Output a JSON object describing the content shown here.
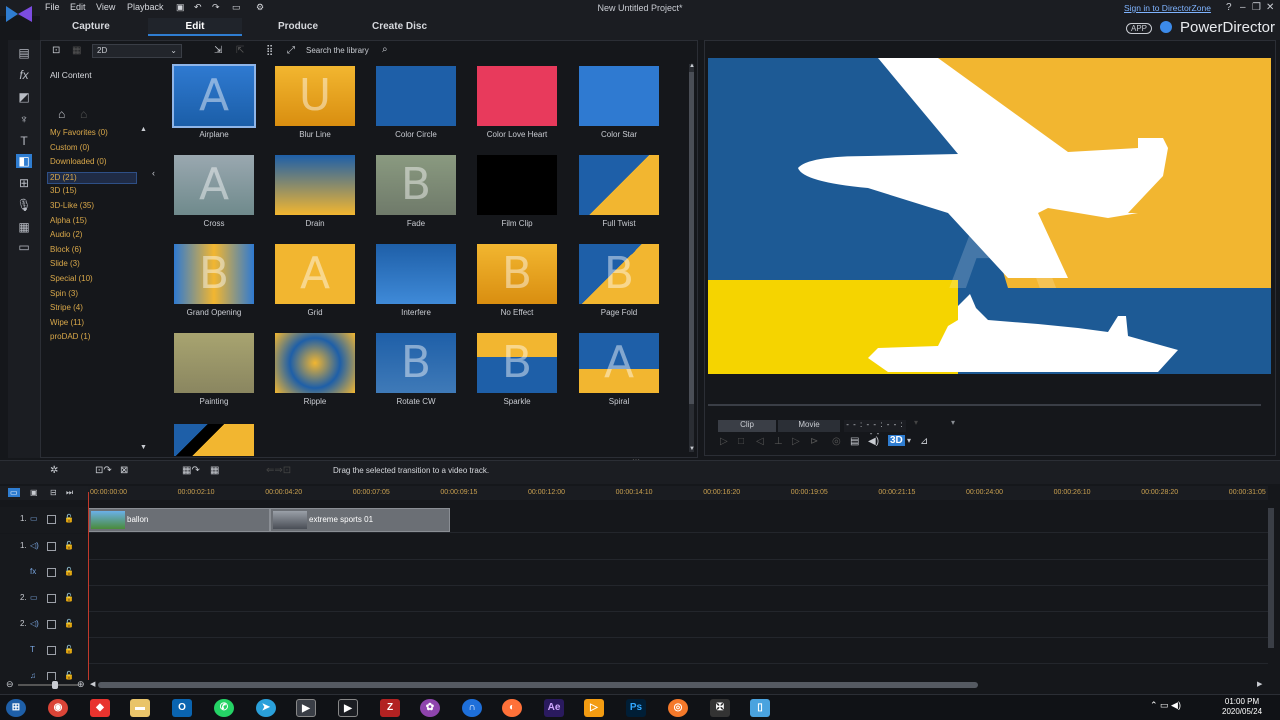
{
  "menu": {
    "file": "File",
    "edit": "Edit",
    "view": "View",
    "playback": "Playback"
  },
  "window": {
    "project_title": "New Untitled Project*",
    "signin": "Sign in to DirectorZone",
    "app_badge": "APP",
    "brand": "PowerDirector"
  },
  "modes": {
    "capture": "Capture",
    "edit": "Edit",
    "produce": "Produce",
    "create_disc": "Create Disc"
  },
  "library": {
    "dropdown": "2D",
    "search_placeholder": "Search the library",
    "all_content": "All Content",
    "categories": [
      {
        "label": "My Favorites  (0)"
      },
      {
        "label": "Custom  (0)"
      },
      {
        "label": "Downloaded  (0)"
      },
      {
        "label": "2D  (21)"
      },
      {
        "label": "3D  (15)"
      },
      {
        "label": "3D-Like  (35)"
      },
      {
        "label": "Alpha  (15)"
      },
      {
        "label": "Audio  (2)"
      },
      {
        "label": "Block  (6)"
      },
      {
        "label": "Slide  (3)"
      },
      {
        "label": "Special  (10)"
      },
      {
        "label": "Spin  (3)"
      },
      {
        "label": "Stripe  (4)"
      },
      {
        "label": "Wipe  (11)"
      },
      {
        "label": "proDAD  (1)"
      }
    ],
    "transitions": [
      {
        "label": "Airplane"
      },
      {
        "label": "Blur Line"
      },
      {
        "label": "Color Circle"
      },
      {
        "label": "Color Love Heart"
      },
      {
        "label": "Color Star"
      },
      {
        "label": "Cross"
      },
      {
        "label": "Drain"
      },
      {
        "label": "Fade"
      },
      {
        "label": "Film Clip"
      },
      {
        "label": "Full Twist"
      },
      {
        "label": "Grand Opening"
      },
      {
        "label": "Grid"
      },
      {
        "label": "Interfere"
      },
      {
        "label": "No Effect"
      },
      {
        "label": "Page Fold"
      },
      {
        "label": "Painting"
      },
      {
        "label": "Ripple"
      },
      {
        "label": "Rotate CW"
      },
      {
        "label": "Sparkle"
      },
      {
        "label": "Spiral"
      }
    ]
  },
  "preview": {
    "clip_tab": "Clip",
    "movie_tab": "Movie",
    "timecode": "- - : - - : - - : - -",
    "mode_3d": "3D"
  },
  "timeline": {
    "hint": "Drag the selected transition to a video track.",
    "ruler": [
      "00:00:00:00",
      "00:00:02:10",
      "00:00:04:20",
      "00:00:07:05",
      "00:00:09:15",
      "00:00:12:00",
      "00:00:14:10",
      "00:00:16:20",
      "00:00:19:05",
      "00:00:21:15",
      "00:00:24:00",
      "00:00:26:10",
      "00:00:28:20",
      "00:00:31:05"
    ],
    "tracks": [
      {
        "label": "1."
      },
      {
        "label": "1."
      },
      {
        "label": ""
      },
      {
        "label": "2."
      },
      {
        "label": "2."
      },
      {
        "label": ""
      },
      {
        "label": ""
      }
    ],
    "clips": [
      {
        "label": "ballon"
      },
      {
        "label": "extreme sports 01"
      }
    ]
  },
  "clock": {
    "time": "01:00 PM",
    "date": "2020/05/24"
  },
  "colors": {
    "accent": "#2f7dd1",
    "category": "#d9a84a",
    "preview_blue": "#1d5a95",
    "preview_yellow": "#f2b630"
  }
}
